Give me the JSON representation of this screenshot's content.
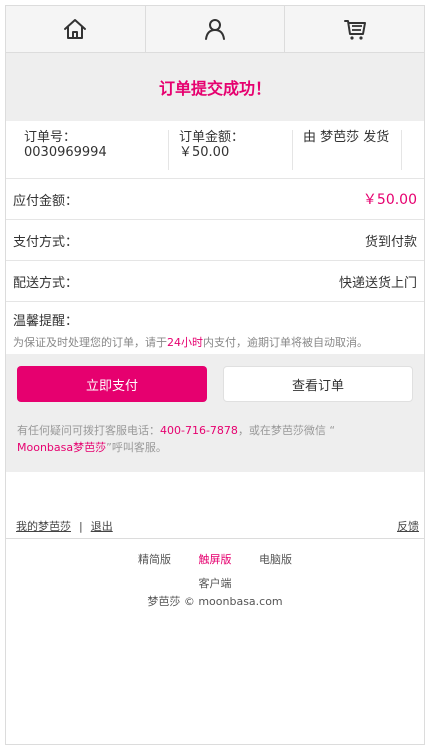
{
  "nav": {
    "items": [
      {
        "icon": "home-icon"
      },
      {
        "icon": "user-icon"
      },
      {
        "icon": "cart-icon"
      }
    ]
  },
  "banner": {
    "title": "订单提交成功！"
  },
  "order": {
    "number_label": "订单号：",
    "number_value": "0030969994",
    "amount_label": "订单金额：",
    "amount_value": "￥50.00",
    "shipper": "由 梦芭莎 发货"
  },
  "rows": {
    "payable_label": "应付金额：",
    "payable_value": "￥50.00",
    "payment_label": "支付方式：",
    "payment_value": "货到付款",
    "delivery_label": "配送方式：",
    "delivery_value": "快递送货上门"
  },
  "tip": {
    "title": "温馨提醒：",
    "text_before": "为保证及时处理您的订单，请于",
    "hours": "24小时",
    "text_after": "内支付，逾期订单将被自动取消。"
  },
  "actions": {
    "pay_label": "立即支付",
    "view_label": "查看订单"
  },
  "service": {
    "text_before": "有任何疑问可拨打客服电话：",
    "phone": "400-716-7878",
    "text_middle": "，或在梦芭莎微信 “",
    "wechat": "Moonbasa梦芭莎",
    "text_after": "”呼叫客服。"
  },
  "footer": {
    "my_account": "我的梦芭莎",
    "separator": "|",
    "logout": "退出",
    "feedback": "反馈",
    "versions": [
      "精简版",
      "触屏版",
      "电脑版"
    ],
    "client": "客户端",
    "copyright": "梦芭莎 © moonbasa.com"
  },
  "colors": {
    "accent": "#e6006f",
    "gray_bg": "#eeeeee"
  }
}
